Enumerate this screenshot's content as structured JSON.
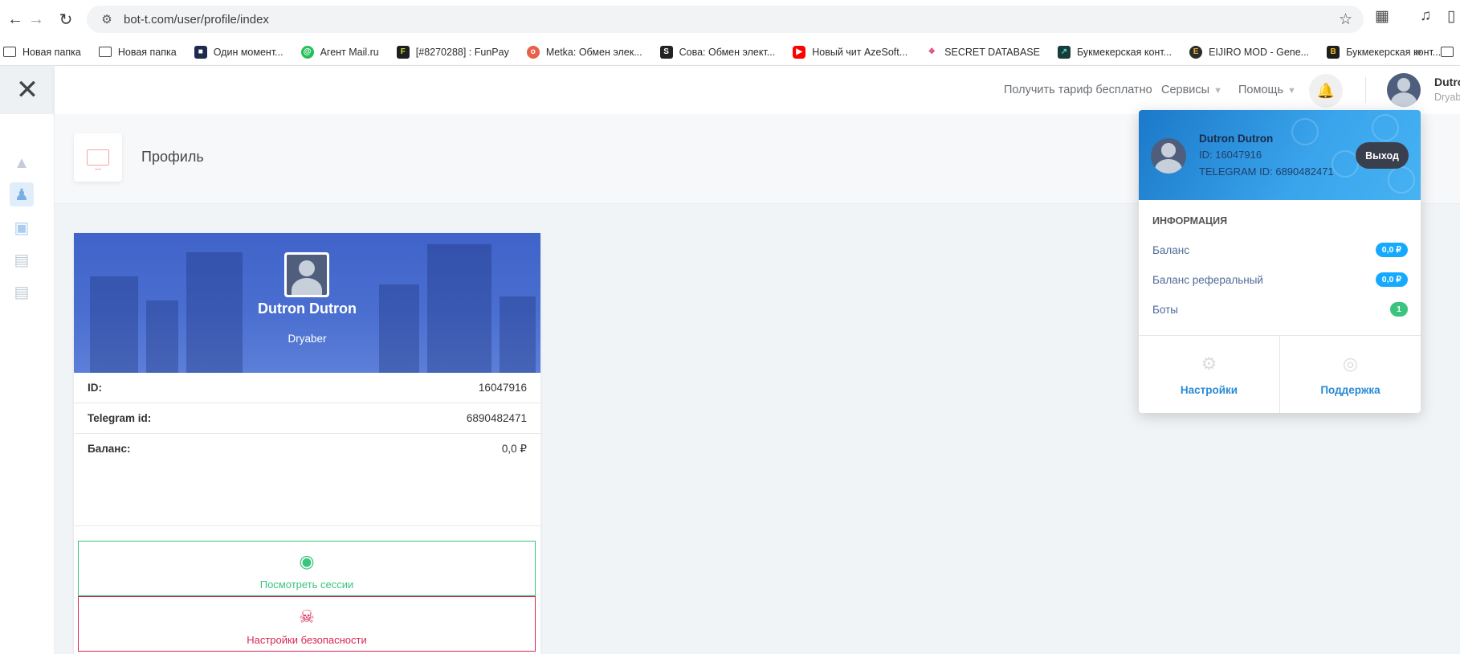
{
  "browser": {
    "url": "bot-t.com/user/profile/index",
    "bookmarks": [
      {
        "label": "Новая папка",
        "icon": "folder-icon"
      },
      {
        "label": "Новая папка",
        "icon": "folder-icon"
      },
      {
        "label": "Один момент...",
        "icon": "site-icon",
        "color": "#1f2a4f"
      },
      {
        "label": "Агент Mail.ru",
        "icon": "mail-agent-icon",
        "color": "#25c05a"
      },
      {
        "label": "[#8270288] : FunPay",
        "icon": "funpay-icon",
        "color": "#1e1e1e"
      },
      {
        "label": "Metka: Обмен элек...",
        "icon": "metka-icon",
        "color": "#e8604a"
      },
      {
        "label": "Сова: Обмен элект...",
        "icon": "owl-icon",
        "color": "#222"
      },
      {
        "label": "Новый чит AzeSoft...",
        "icon": "youtube-icon",
        "color": "#ff0000"
      },
      {
        "label": "SECRET DATABASE",
        "icon": "database-icon",
        "color": "#d9507a"
      },
      {
        "label": "Букмекерская конт...",
        "icon": "bookmaker-icon",
        "color": "#1b3a3a"
      },
      {
        "label": "EIJIRO MOD - Gene...",
        "icon": "eijiro-icon",
        "color": "#2b2b2b"
      },
      {
        "label": "Букмекерская конт...",
        "icon": "bookmaker2-icon",
        "color": "#1e1e1e"
      }
    ]
  },
  "topbar": {
    "free_plan": "Получить тариф бесплатно",
    "services": "Сервисы",
    "help": "Помощь",
    "user_name": "Dutron",
    "user_sub": "Dryab"
  },
  "page": {
    "title": "Профиль"
  },
  "profile": {
    "name": "Dutron Dutron",
    "username": "Dryaber",
    "rows": [
      {
        "label": "ID:",
        "value": "16047916"
      },
      {
        "label": "Telegram id:",
        "value": "6890482471"
      },
      {
        "label": "Баланс:",
        "value": "0,0 ₽"
      }
    ],
    "view_sessions": "Посмотреть сессии",
    "security_settings": "Настройки безопасности"
  },
  "dropdown": {
    "name": "Dutron Dutron",
    "id_line": "ID: 16047916",
    "telegram_line": "TELEGRAM ID: 6890482471",
    "logout": "Выход",
    "section": "Информация",
    "items": [
      {
        "label": "Баланс",
        "badge": "0,0 ₽",
        "color": "#16aaff"
      },
      {
        "label": "Баланс реферальный",
        "badge": "0,0 ₽",
        "color": "#16aaff"
      },
      {
        "label": "Боты",
        "badge": "1",
        "color": "#3ac47d"
      }
    ],
    "settings": "Настройки",
    "support": "Поддержка"
  }
}
